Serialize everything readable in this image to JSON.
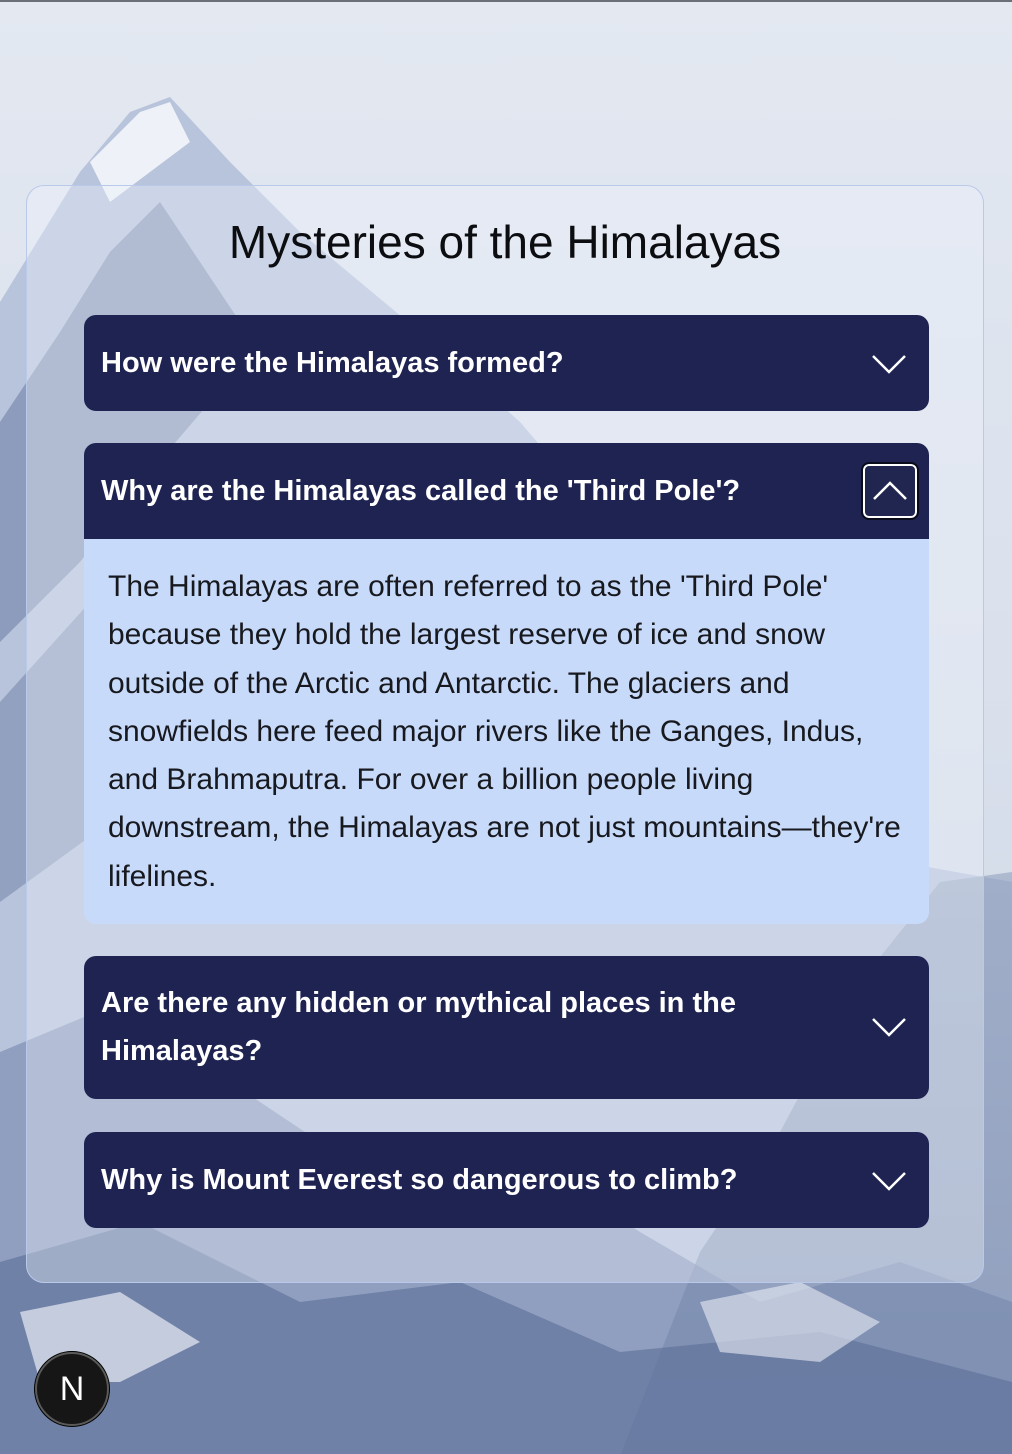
{
  "page": {
    "title": "Mysteries of the Himalayas"
  },
  "faq": [
    {
      "question": "How were the Himalayas formed?",
      "expanded": false,
      "icon": "chevron-down-icon"
    },
    {
      "question": "Why are the Himalayas called the 'Third Pole'?",
      "expanded": true,
      "icon": "chevron-up-icon",
      "answer": "The Himalayas are often referred to as the 'Third Pole' because they hold the largest reserve of ice and snow outside of the Arctic and Antarctic. The glaciers and snowfields here feed major rivers like the Ganges, Indus, and Brahmaputra. For over a billion people living downstream, the Himalayas are not just mountains—they're lifelines."
    },
    {
      "question": "Are there any hidden or mythical places in the Himalayas?",
      "expanded": false,
      "icon": "chevron-down-icon"
    },
    {
      "question": "Why is Mount Everest so dangerous to climb?",
      "expanded": false,
      "icon": "chevron-down-icon"
    }
  ],
  "fab": {
    "label": "N"
  },
  "colors": {
    "header_bg": "#1e2352",
    "answer_bg": "#c8dafa",
    "card_border": "#b9c9ea"
  }
}
